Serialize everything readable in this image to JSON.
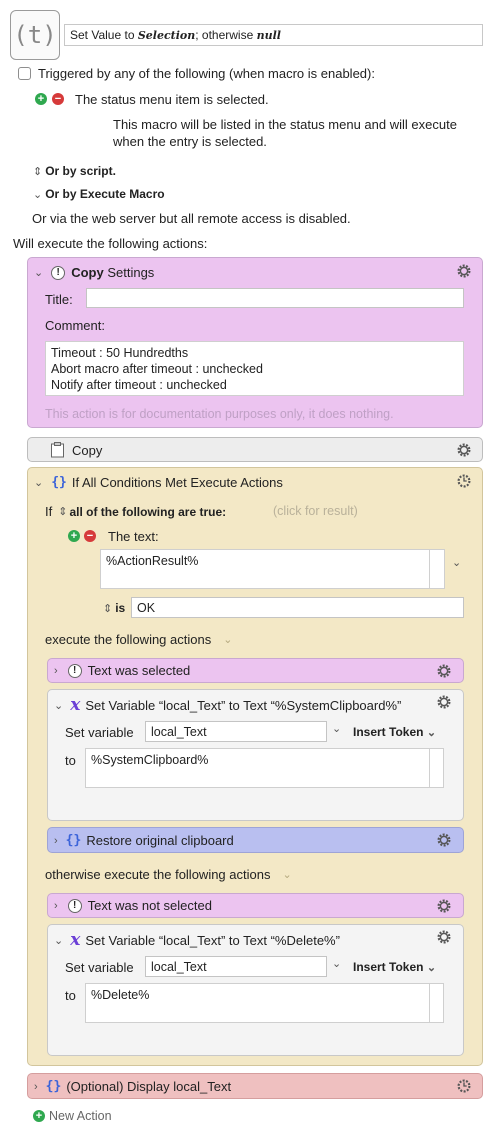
{
  "macro": {
    "icon_text": "(t)",
    "name_prefix": "Set Value to ",
    "name_italic1": "Selection",
    "name_mid": "; otherwise ",
    "name_italic2": "null"
  },
  "triggers": {
    "header": "Triggered by any of the following (when macro is enabled):",
    "status_item": "The status menu item is selected.",
    "status_desc_line1": "This macro will be listed in the status menu and will execute",
    "status_desc_line2": "when the entry is selected.",
    "or_script": "Or by script.",
    "or_execute": "Or by Execute Macro",
    "web_server": "Or via the web server but all remote access is disabled."
  },
  "will_execute": "Will execute the following actions:",
  "copy_settings": {
    "title_bold": "Copy",
    "title_rest": " Settings",
    "title_label": "Title:",
    "comment_label": "Comment:",
    "comment_lines": [
      "Timeout : 50 Hundredths",
      "Abort macro after timeout : unchecked",
      "Notify after timeout : unchecked"
    ],
    "footer": "This action is for documentation purposes only, it does nothing."
  },
  "copy_action": {
    "label": "Copy"
  },
  "if_block": {
    "title": "If All Conditions Met Execute Actions",
    "if_label": "If",
    "cond_mode": "all of the following are true:",
    "click_result": "(click for result)",
    "the_text": "The text:",
    "text_value": "%ActionResult%",
    "is_label": "is",
    "is_value": "OK",
    "execute_label": "execute the following actions",
    "otherwise_label": "otherwise execute the following actions"
  },
  "then_actions": {
    "comment1": "Text was selected",
    "setvar_title": "Set Variable “local_Text” to Text “%SystemClipboard%”",
    "setvar_label": "Set variable",
    "setvar_name": "local_Text",
    "insert_token": "Insert Token",
    "to_label": "to",
    "to_value": "%SystemClipboard%",
    "restore": "Restore original clipboard"
  },
  "else_actions": {
    "comment1": "Text was not selected",
    "setvar_title": "Set Variable “local_Text” to Text “%Delete%”",
    "setvar_label": "Set variable",
    "setvar_name": "local_Text",
    "insert_token": "Insert Token",
    "to_label": "to",
    "to_value": "%Delete%"
  },
  "display_action": {
    "label": "(Optional) Display local_Text"
  },
  "new_action": "New Action",
  "icons": [
    "t-icon",
    "checkbox-icon",
    "plus-icon",
    "minus-icon",
    "updown-icon",
    "chevron-icon",
    "gear-icon",
    "exclaim-icon",
    "braces-icon",
    "variable-icon",
    "clipboard-icon",
    "clock-gear-icon"
  ],
  "colors": {
    "comment_purple": "#ecc4f0",
    "if_tan": "#f3e8c6",
    "group_blue": "#b9bff0",
    "display_pink": "#efc0c0",
    "copy_gray": "#ededed"
  }
}
